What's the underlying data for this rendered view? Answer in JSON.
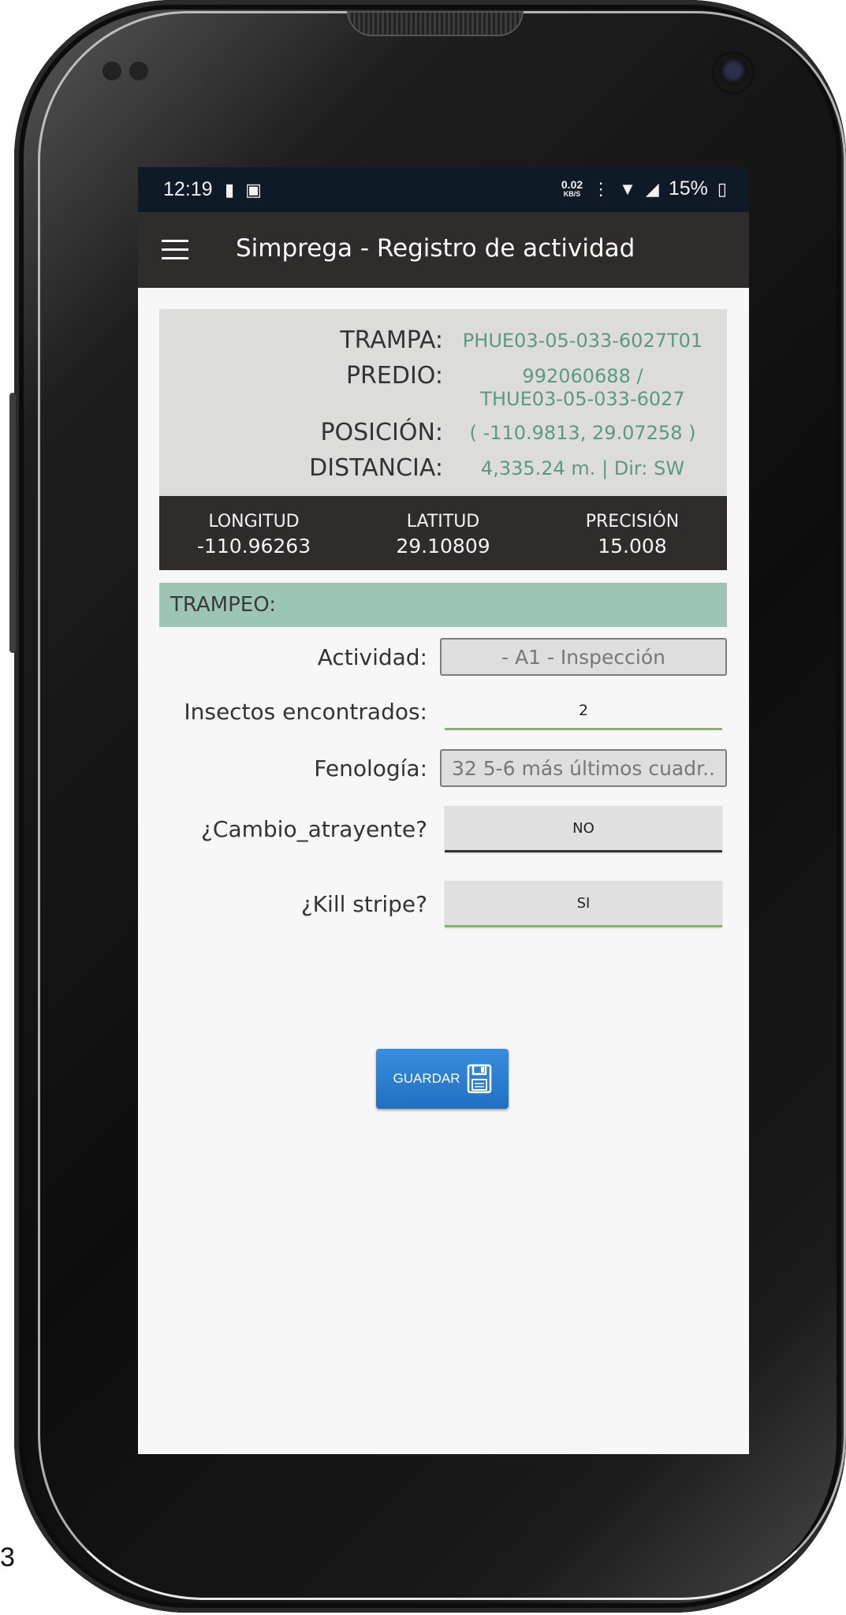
{
  "status_bar": {
    "time": "12:19",
    "notification_icons": [
      "chat-icon",
      "sim-icon"
    ],
    "net_speed_value": "0.02",
    "net_speed_unit": "KB/S",
    "battery": "15%"
  },
  "app_bar": {
    "title": "Simprega - Registro de actividad"
  },
  "info": {
    "trampa_label": "TRAMPA:",
    "trampa_value": "PHUE03-05-033-6027T01",
    "predio_label": "PREDIO:",
    "predio_value_line1": "992060688 /",
    "predio_value_line2": "THUE03-05-033-6027",
    "posicion_label": "POSICIÓN:",
    "posicion_value": "( -110.9813, 29.07258 )",
    "distancia_label": "DISTANCIA:",
    "distancia_value": "4,335.24 m. | Dir: SW"
  },
  "gps": {
    "longitud_label": "LONGITUD",
    "longitud_value": "-110.96263",
    "latitud_label": "LATITUD",
    "latitud_value": "29.10809",
    "precision_label": "PRECISIÓN",
    "precision_value": "15.008"
  },
  "form": {
    "section_title": "TRAMPEO:",
    "actividad_label": "Actividad:",
    "actividad_value": "- A1 - Inspección",
    "insectos_label": "Insectos encontrados:",
    "insectos_value": "2",
    "fenologia_label": "Fenología:",
    "fenologia_value": "32 5-6 más últimos cuadr..",
    "cambio_label": "¿Cambio_atrayente?",
    "cambio_value": "NO",
    "kill_label": "¿Kill stripe?",
    "kill_value": "SI",
    "save_label": "GUARDAR"
  },
  "page_marker": "3",
  "colors": {
    "app_bar": "#2f2c2b",
    "status_bar": "#0e1a26",
    "value_green": "#5b9a7e",
    "section_header": "#9dc5b5",
    "accent_green": "#7dbb63",
    "save_blue": "#2a7fd0"
  }
}
